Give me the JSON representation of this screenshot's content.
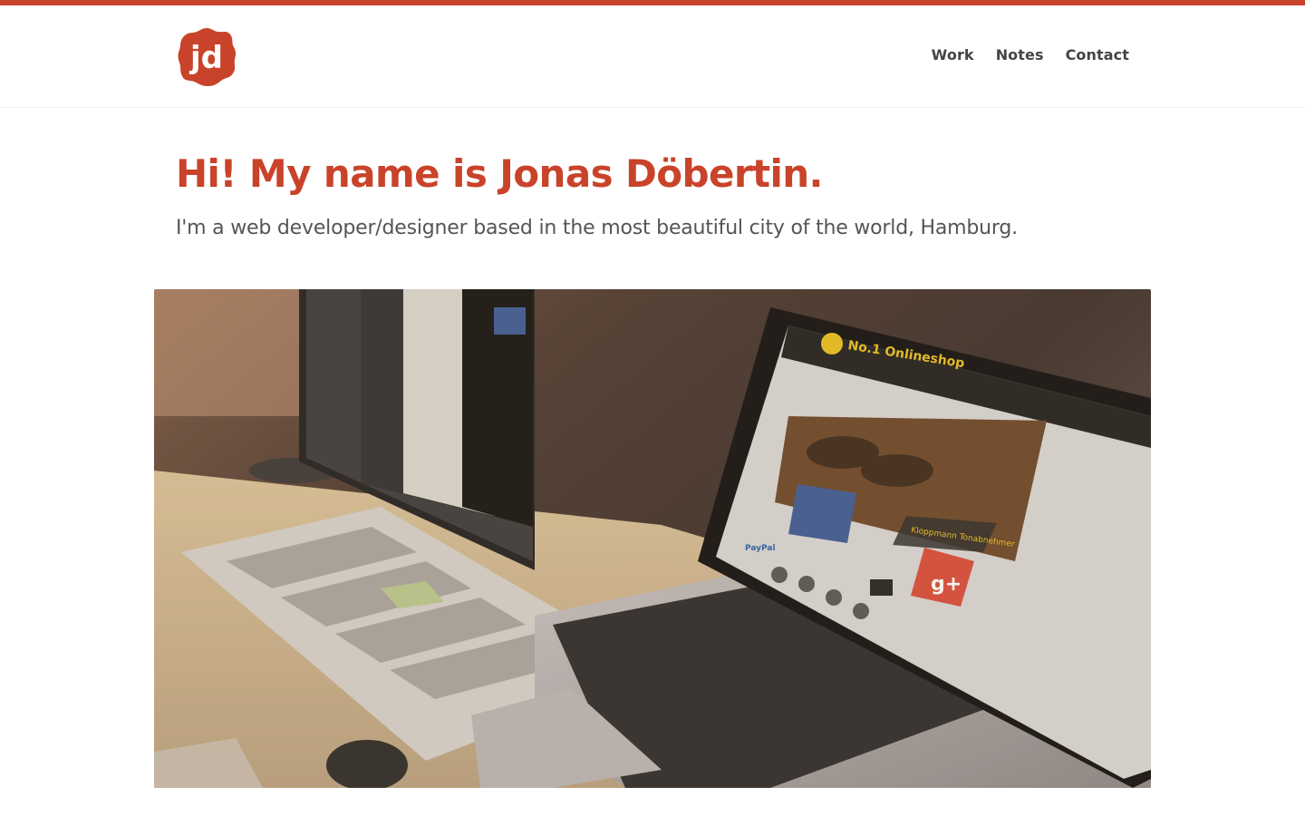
{
  "logo": {
    "text": "jd",
    "color": "#c9432a"
  },
  "nav": {
    "items": [
      {
        "label": "Work"
      },
      {
        "label": "Notes"
      },
      {
        "label": "Contact"
      }
    ]
  },
  "hero": {
    "title": "Hi! My name is Jonas Döbertin.",
    "subtitle": "I'm a web developer/designer based in the most beautiful city of the world, Hamburg."
  },
  "colors": {
    "accent": "#c9432a",
    "nav_text": "#444444",
    "subtitle_text": "#555555"
  },
  "image": {
    "shop_title": "No.1 Onlineshop",
    "shop_subtitle": "Kloppmann Tonabnehmer",
    "social_badge": "g+",
    "payment_label": "PayPal"
  }
}
